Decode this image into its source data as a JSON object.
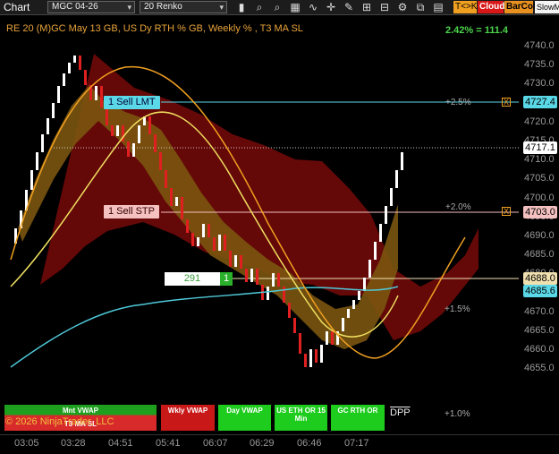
{
  "toolbar": {
    "title": "Chart",
    "instrument": "MGC 04-26",
    "bar_type": "20 Renko",
    "buttons": {
      "tk": "T<>K",
      "cloud": "Cloud",
      "barcol": "BarCol",
      "slow": "SlowM"
    }
  },
  "chart_info": {
    "description": "RE 20  (M)GC May 13 GB, US Dy RTH % GB, Weekly % , T3 MA SL",
    "performance": "2.42% = 111.4"
  },
  "price_axis": {
    "ticks": [
      "4740.0",
      "4735.0",
      "4730.0",
      "4725.0",
      "4720.0",
      "4715.0",
      "4710.0",
      "4705.0",
      "4700.0",
      "4695.0",
      "4690.0",
      "4685.0",
      "4680.0",
      "4675.0",
      "4670.0",
      "4665.0",
      "4660.0",
      "4655.0"
    ],
    "tags": {
      "sell_lmt": "4727.4",
      "last": "4717.1",
      "sell_stp": "4703.0",
      "entry": "4688.0",
      "ma": "4685.6"
    }
  },
  "percent_levels": [
    "+2.5%",
    "+2.0%",
    "+1.5%",
    "+1.0%"
  ],
  "orders": {
    "sell_lmt_label": "1 Sell LMT",
    "sell_stp_label": "1 Sell STP",
    "close_symbol": "X"
  },
  "position": {
    "pnl": "291",
    "qty": "1"
  },
  "vwap_buttons": {
    "mnt": "Mnt VWAP",
    "t3": "T3 MA SL",
    "wkly": "Wkly VWAP",
    "day": "Day VWAP",
    "us_eth": "US ETH OR 15 Min",
    "gc_rth": "GC RTH OR",
    "dpp": "DPP"
  },
  "copyright": "© 2026 NinjaTrader, LLC",
  "time_axis": [
    "03:05",
    "03:28",
    "04:51",
    "05:41",
    "06:07",
    "06:29",
    "06:46",
    "07:17"
  ],
  "colors": {
    "cloud_red": "#6a0808",
    "cloud_brown": "#7a5510",
    "renko_up": "#ffffff",
    "renko_down": "#e02020",
    "ma_cyan": "#4fc8d8",
    "ma_yellow": "#f0e060",
    "ma_orange": "#f0a020",
    "perf_green": "#4cd44c"
  }
}
